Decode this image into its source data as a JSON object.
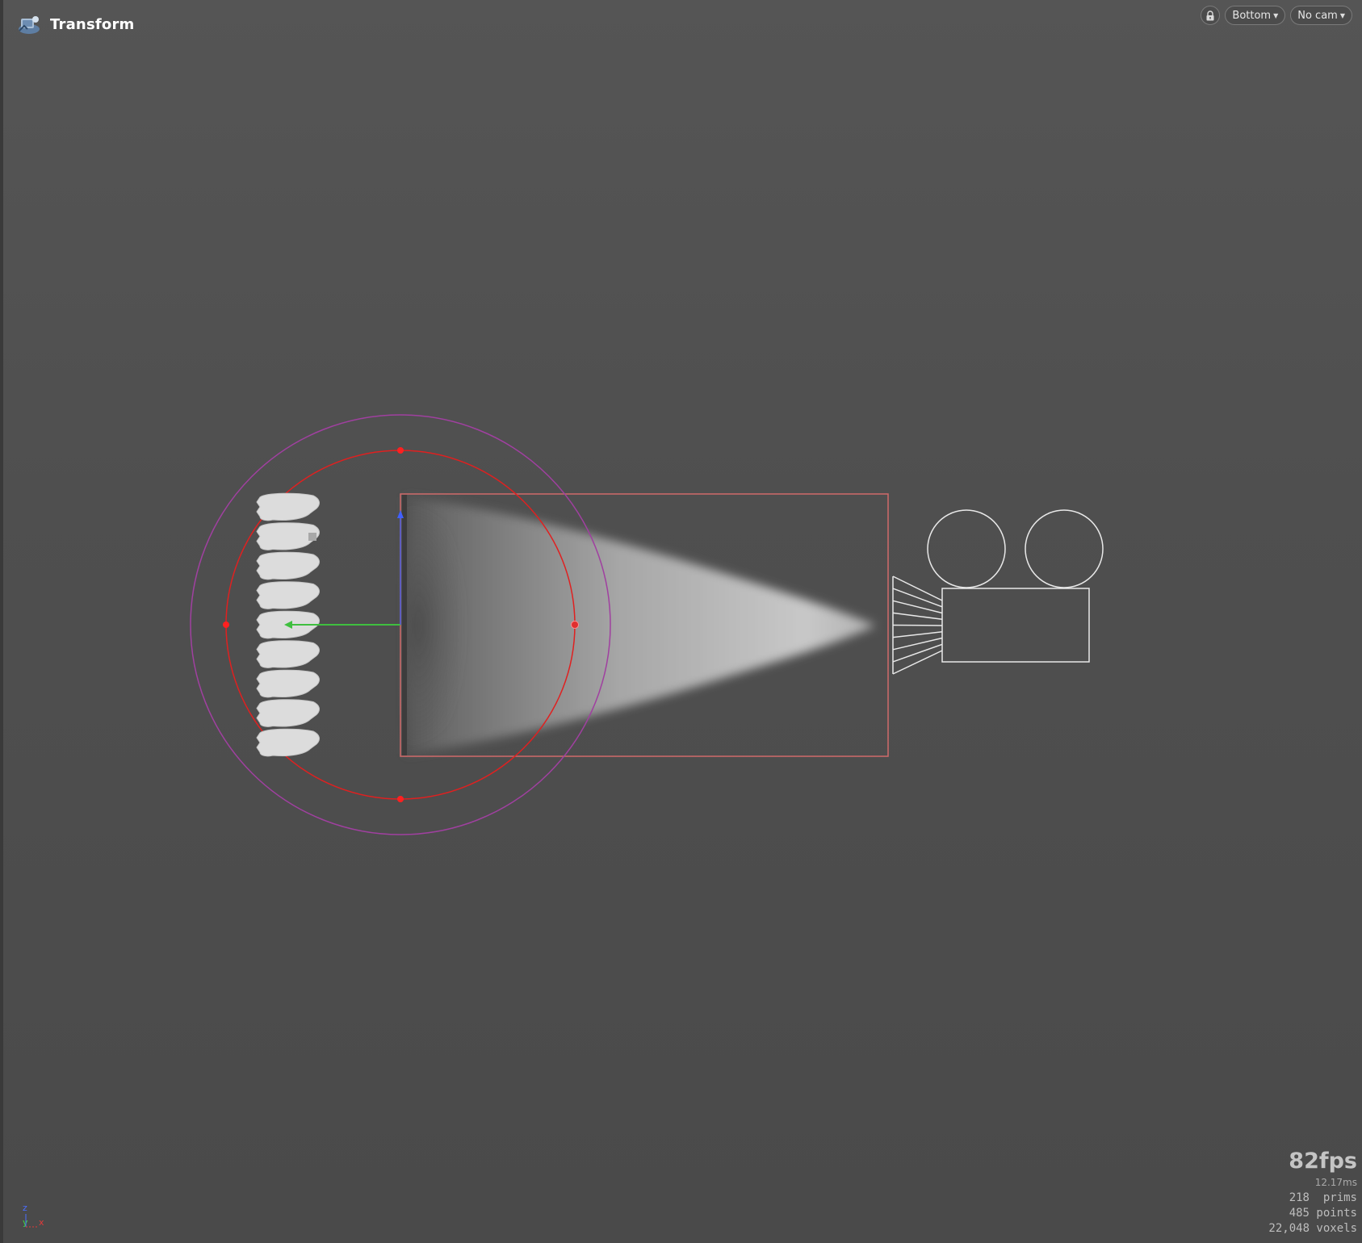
{
  "header": {
    "tool_name": "Transform",
    "tool_icon": "transform-tool-icon"
  },
  "view_controls": {
    "lock_icon": "lock-icon",
    "view_label": "Bottom",
    "camera_label": "No cam"
  },
  "stats": {
    "fps": "82fps",
    "frame_time": "12.17ms",
    "prims": "218  prims",
    "points": "485 points",
    "voxels": "22,048 voxels"
  },
  "axis_indicator": {
    "z": "z",
    "y": "y",
    "x": "x"
  },
  "colors": {
    "background": "#4f4f4f",
    "bounding_box": "#d06a6a",
    "rotate_ring_inner": "#e02020",
    "rotate_ring_outer": "#a040a0",
    "handle_y_axis": "#3fbf3f",
    "handle_z_axis": "#4060ff",
    "camera_wire": "#e8e8e8",
    "smoke": "#bdbdbd",
    "fps_text": "#c4c4c4"
  }
}
